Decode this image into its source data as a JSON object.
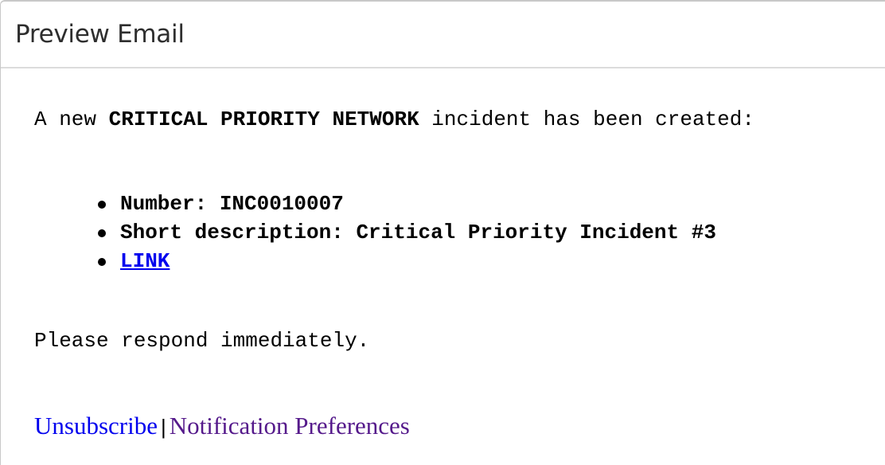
{
  "dialog": {
    "title": "Preview Email"
  },
  "email": {
    "intro_prefix": "A new ",
    "intro_bold": "CRITICAL PRIORITY NETWORK",
    "intro_suffix": " incident has been created:",
    "details": [
      {
        "text": "Number: INC0010007"
      },
      {
        "text": "Short description: Critical Priority Incident #3"
      },
      {
        "link_text": "LINK"
      }
    ],
    "closing": "Please respond immediately."
  },
  "footer": {
    "unsubscribe_label": "Unsubscribe",
    "separator": "|",
    "preferences_label": "Notification Preferences"
  },
  "colors": {
    "link_unvisited": "#0000ee",
    "link_visited": "#551a8b"
  }
}
